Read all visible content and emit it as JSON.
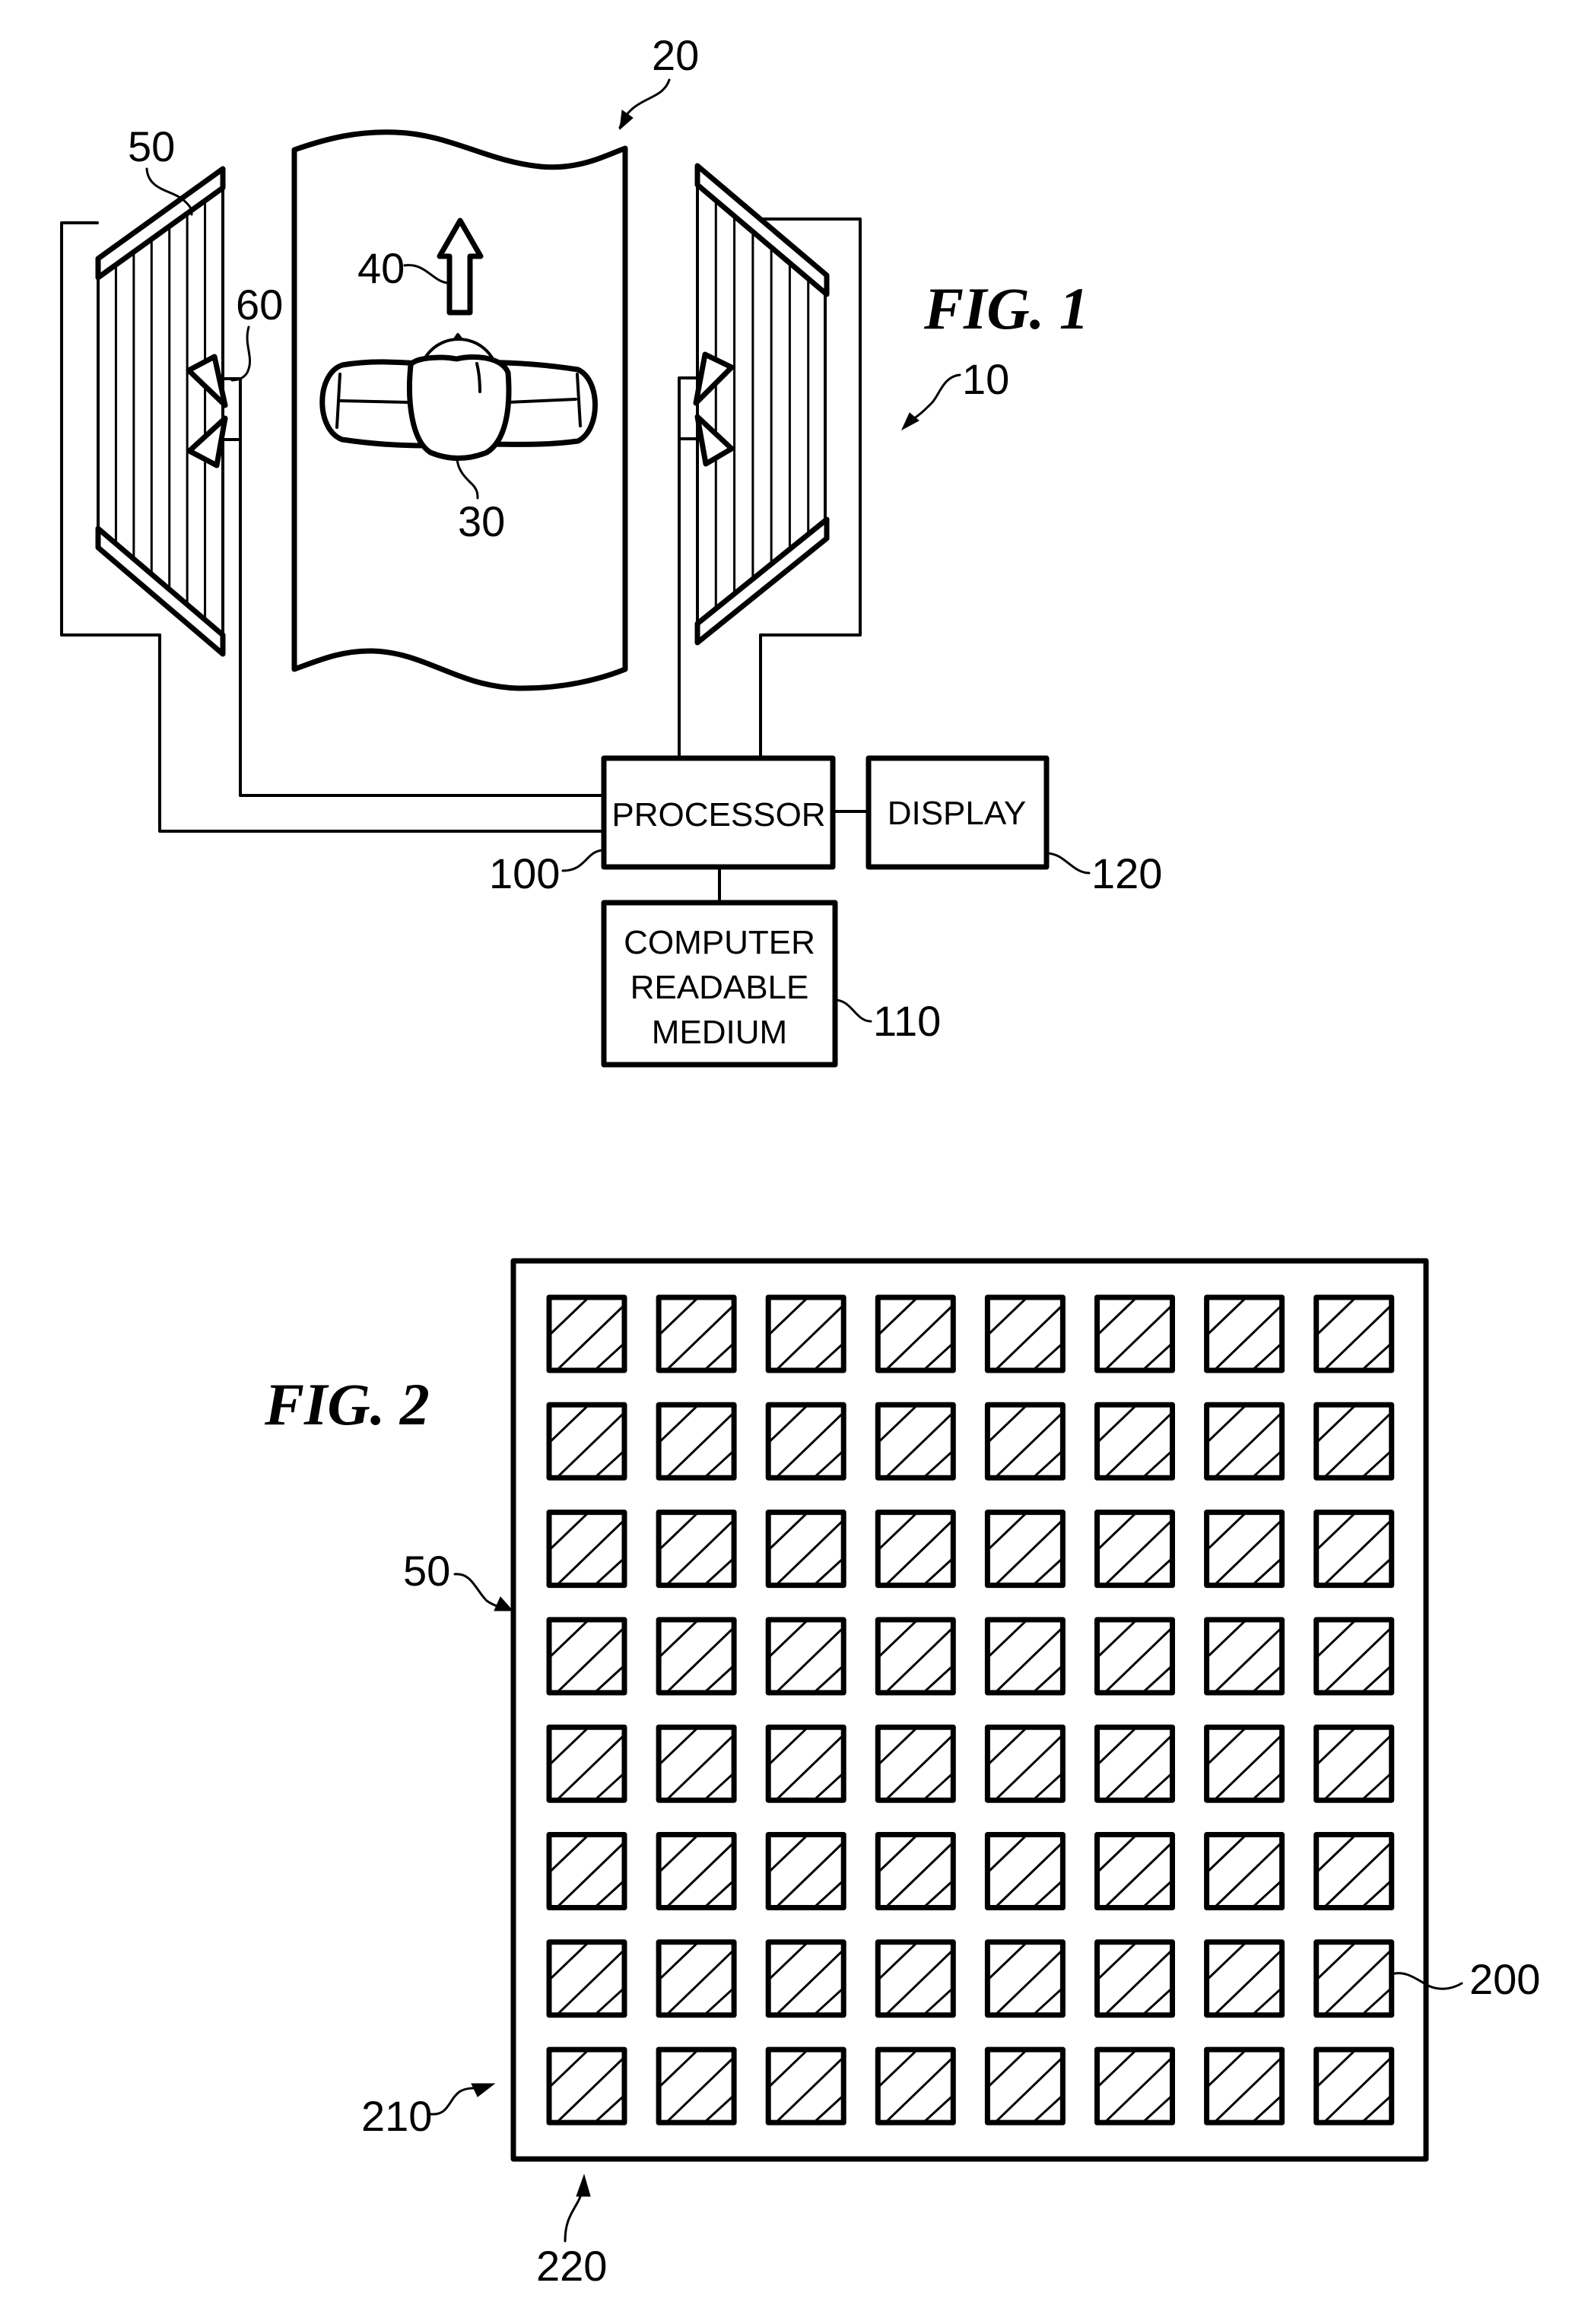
{
  "figures": [
    {
      "id": "fig1",
      "title": "FIG. 1",
      "system_ref": "10",
      "conveyor": {
        "ref": "20",
        "direction_arrow_ref": "40",
        "direction": "up"
      },
      "person": {
        "ref": "30"
      },
      "panels": [
        {
          "side": "left",
          "ref": "50",
          "slat_count": 7
        },
        {
          "side": "right",
          "ref": "",
          "slat_count": 7
        }
      ],
      "sensor": {
        "ref": "60"
      },
      "blocks": {
        "processor": {
          "label": "PROCESSOR",
          "ref": "100"
        },
        "display": {
          "label": "DISPLAY",
          "ref": "120"
        },
        "medium": {
          "lines": [
            "COMPUTER",
            "READABLE",
            "MEDIUM"
          ],
          "ref": "110"
        }
      }
    },
    {
      "id": "fig2",
      "title": "FIG. 2",
      "panel_ref": "50",
      "element_ref": "200",
      "row_ref": "210",
      "column_ref": "220",
      "grid": {
        "rows": 8,
        "cols": 8
      }
    }
  ]
}
